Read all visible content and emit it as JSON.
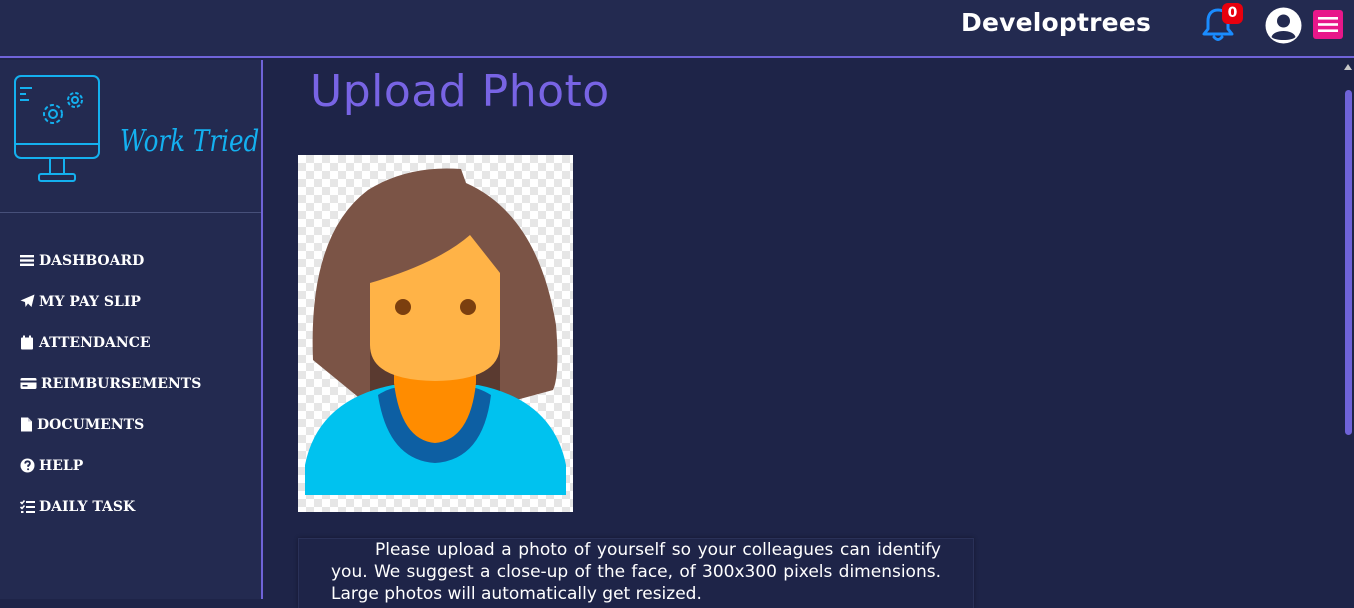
{
  "header": {
    "company_name": "Developtrees",
    "notification_count": "0"
  },
  "sidebar": {
    "logo_text": "Work Tried",
    "items": [
      {
        "label": "DASHBOARD",
        "icon": "bars-icon"
      },
      {
        "label": "MY PAY SLIP",
        "icon": "paper-plane-icon"
      },
      {
        "label": "ATTENDANCE",
        "icon": "calendar-icon"
      },
      {
        "label": "REIMBURSEMENTS",
        "icon": "credit-card-icon"
      },
      {
        "label": "DOCUMENTS",
        "icon": "file-icon"
      },
      {
        "label": "HELP",
        "icon": "question-circle-icon"
      },
      {
        "label": "DAILY TASK",
        "icon": "task-list-icon"
      }
    ]
  },
  "main": {
    "title": "Upload Photo",
    "info_text": "Please upload a photo of yourself so your colleagues can identify you. We suggest a close-up of the face, of 300x300 pixels dimensions. Large photos will automatically get resized."
  },
  "colors": {
    "accent": "#6f63d8",
    "title": "#7864e4",
    "menu_button": "#e8178a",
    "badge": "#e8000d",
    "bell": "#1a8cff",
    "logo": "#14b0ef",
    "background": "#1e2448",
    "panel": "#232a50"
  }
}
